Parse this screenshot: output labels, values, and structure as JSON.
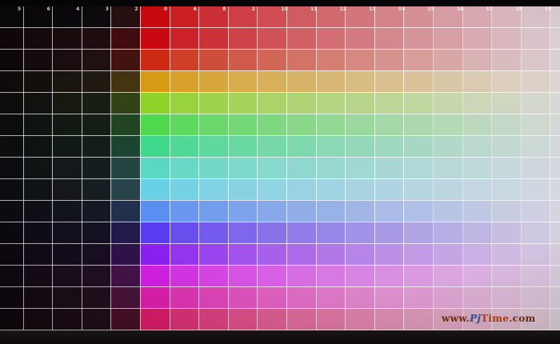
{
  "column_labels": [
    "5",
    "6",
    "4",
    "3",
    "2",
    "0",
    "6",
    "8",
    "2",
    "10",
    "11",
    "12",
    "13",
    "14",
    "15",
    "16",
    "17",
    "18",
    "19",
    "20"
  ],
  "watermark": {
    "prefix": "www.",
    "brand_a": "Pj",
    "brand_b": "Time",
    "suffix": ".com"
  },
  "colors": {
    "row_hues": [
      "#c80a10",
      "#cc2a12",
      "#d69a14",
      "#8fd22a",
      "#4ed84e",
      "#3fd88c",
      "#5ad8c4",
      "#6ad0e6",
      "#5a8ef0",
      "#5a3cf0",
      "#8a20f0",
      "#d420e6",
      "#e020b0",
      "#dc1c6a",
      "#d4101e"
    ],
    "neutral_dark": "#0a080b",
    "neutral_light": "#dcd8df"
  }
}
